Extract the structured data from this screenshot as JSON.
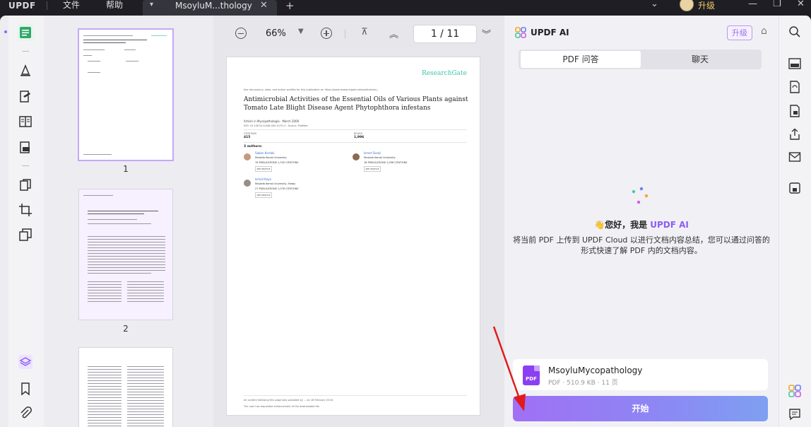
{
  "app": {
    "logo": "UPDF",
    "menu": [
      "文件",
      "帮助"
    ],
    "tab_name": "MsoyluM...thology",
    "upgrade": "升级"
  },
  "toolbar": {
    "zoom": "66%",
    "page_current": "1",
    "page_total": "11",
    "page_display": "1  /  11"
  },
  "thumbnails": {
    "pages": [
      "1",
      "2"
    ]
  },
  "document": {
    "brand": "ResearchGate",
    "header_note": "See discussions, stats, and author profiles for this publication at: https://www.researchgate.net/publication/...",
    "title": "Antimicrobial Activities of the Essential Oils of Various Plants against Tomato Late Blight Disease Agent Phytophthora infestans",
    "article_line": "Article  in  Mycopathologia · March 2006",
    "doi_line": "DOI: 10.1007/s11046-005-0170-4 · Source: PubMed",
    "citations_label": "CITATIONS",
    "citations_value": "415",
    "reads_label": "READS",
    "reads_value": "1,996",
    "authors_label": "3 authors:",
    "authors": [
      {
        "name": "Saban Kordali",
        "affil": "Mustafa Kemal University",
        "stats": "76 PUBLICATIONS   1,330 CITATIONS"
      },
      {
        "name": "Ismet Sisaki",
        "affil": "Mustafa Kemal University",
        "stats": "18 PUBLICATIONS   1,096 CITATIONS"
      },
      {
        "name": "Ismail Kaya",
        "affil": "Mustafa Kemal University, Hatay",
        "stats": "27 PUBLICATIONS   1,078 CITATIONS"
      }
    ],
    "see_profile": "SEE PROFILE",
    "footer1": "All content following this page was uploaded by ... on 18 February 2016.",
    "footer2": "The user has requested enhancement of the downloaded file."
  },
  "ai": {
    "title": "UPDF AI",
    "upgrade": "升级",
    "tabs": [
      "PDF 问答",
      "聊天"
    ],
    "hello_prefix": "您好，我是 ",
    "hello_name": "UPDF AI",
    "intro": "将当前 PDF 上传到 UPDF Cloud 以进行文档内容总结，您可以通过问答的形式快速了解 PDF 内的文档内容。",
    "file_name": "MsoyluMycopathology",
    "file_meta": "PDF · 510.9 KB · 11 页",
    "file_icon_label": "PDF",
    "start": "开始"
  },
  "colors": {
    "accent": "#8b5cf6",
    "brand_green": "#41c4a8",
    "arrow": "#e11b1b"
  }
}
